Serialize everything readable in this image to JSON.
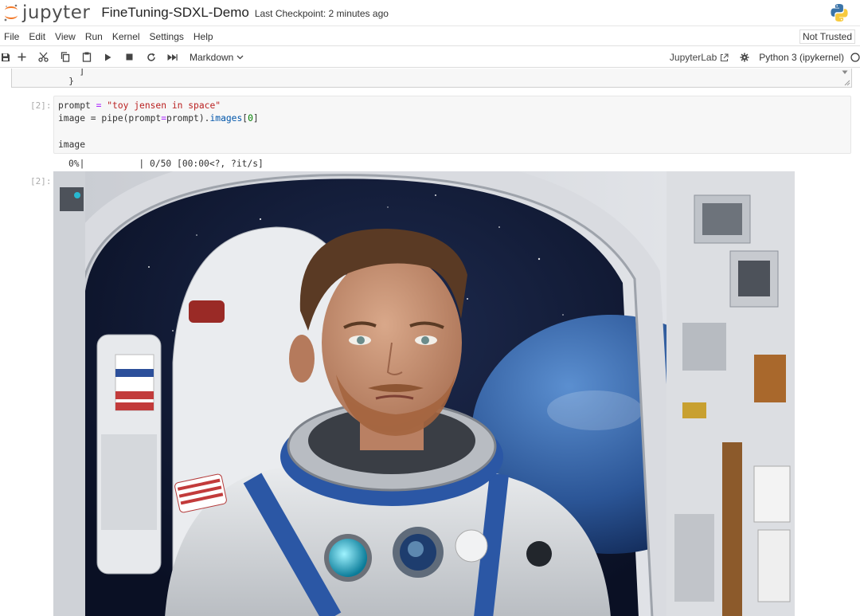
{
  "header": {
    "logo_text": "jupyter",
    "notebook_title": "FineTuning-SDXL-Demo",
    "checkpoint": "Last Checkpoint: 2 minutes ago"
  },
  "menubar": {
    "items": [
      "File",
      "Edit",
      "View",
      "Run",
      "Kernel",
      "Settings",
      "Help"
    ],
    "trust_status": "Not Trusted"
  },
  "toolbar": {
    "icons": [
      "save-icon",
      "add-icon",
      "cut-icon",
      "copy-icon",
      "paste-icon",
      "run-icon",
      "stop-icon",
      "restart-icon",
      "run-all-icon"
    ],
    "cell_type": "Markdown",
    "jupyterlab_label": "JupyterLab",
    "kernel_name": "Python 3 (ipykernel)"
  },
  "notebook": {
    "prev_cell_lines": [
      "    ]",
      "  }"
    ],
    "input_prompt": "[2]:",
    "output_prompt": "[2]:",
    "code": {
      "line1_var": "prompt",
      "line1_op": " = ",
      "line1_str": "\"toy jensen in space\"",
      "line2_a": "image = pipe(prompt",
      "line2_eq": "=",
      "line2_b": "prompt).",
      "line2_attr": "images",
      "line2_c": "[",
      "line2_num": "0",
      "line2_d": "]",
      "line4": "image"
    },
    "progress": "0%|          | 0/50 [00:00<?, ?it/s]",
    "output_image_alt": "astronaut in a spacecraft"
  },
  "colors": {
    "jupyter_orange": "#f37726",
    "string_red": "#ba2121",
    "number_green": "#008000"
  }
}
